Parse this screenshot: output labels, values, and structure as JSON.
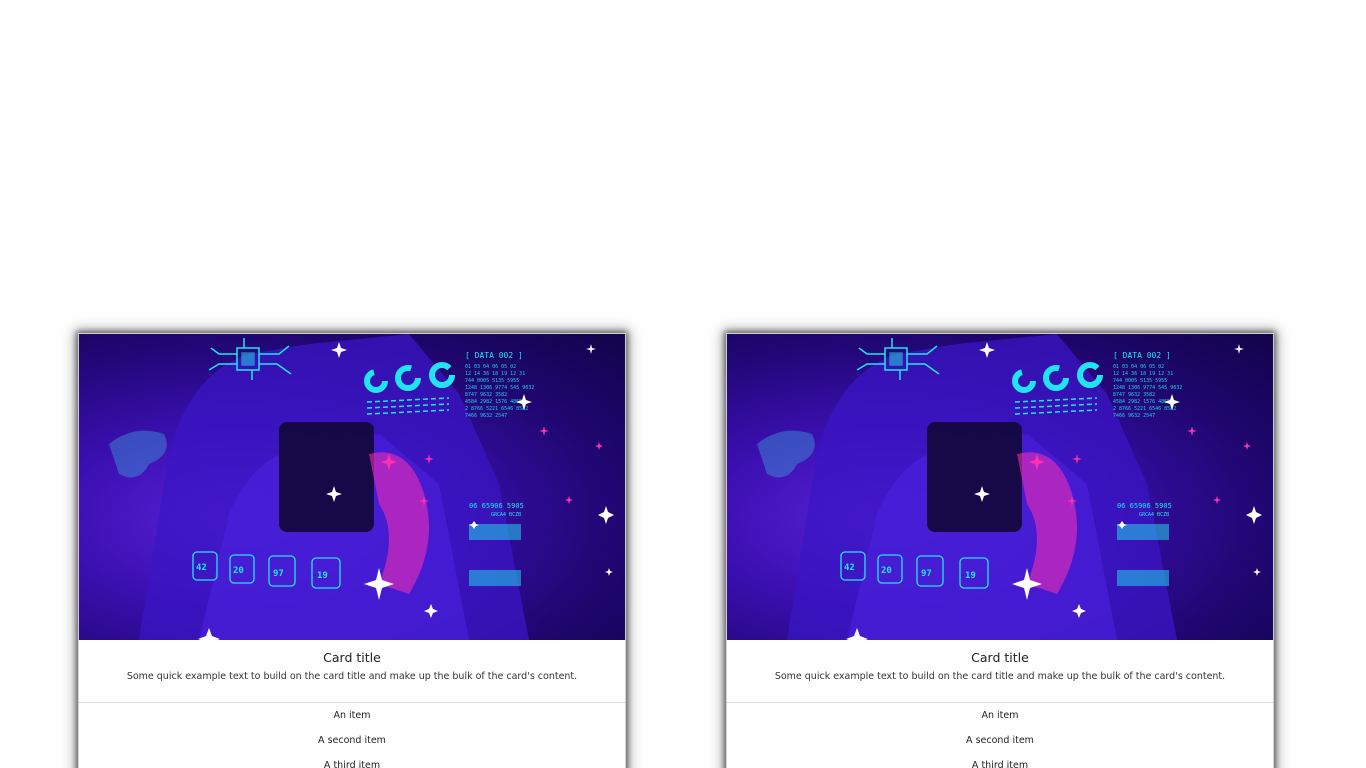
{
  "cards": [
    {
      "title": "Card title",
      "text": "Some quick example text to build on the card title and make up the bulk of the card's content.",
      "items": [
        "An item",
        "A second item",
        "A third item"
      ],
      "image": {
        "description_icon": "tech-hologram-image",
        "hud_data_label": "[ DATA 002 ]",
        "hud_tiles": [
          "42",
          "20",
          "97",
          "19"
        ],
        "hud_numbers": "06 65906 5905",
        "hud_code": "GRCA4 BCZB"
      }
    },
    {
      "title": "Card title",
      "text": "Some quick example text to build on the card title and make up the bulk of the card's content.",
      "items": [
        "An item",
        "A second item",
        "A third item"
      ],
      "image": {
        "description_icon": "tech-hologram-image",
        "hud_data_label": "[ DATA 002 ]",
        "hud_tiles": [
          "42",
          "20",
          "97",
          "19"
        ],
        "hud_numbers": "06 65906 5905",
        "hud_code": "GRCA4 BCZB"
      }
    }
  ],
  "colors": {
    "accent_cyan": "#22e4f0",
    "accent_magenta": "#ff2fb0",
    "image_bg": "#2a0a9a"
  }
}
